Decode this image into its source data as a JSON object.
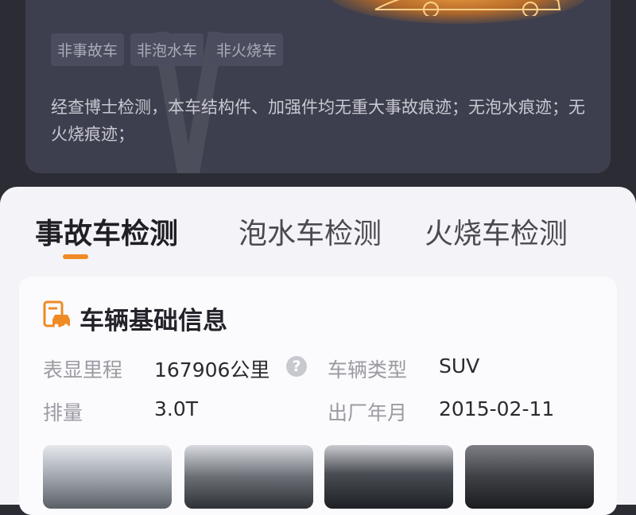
{
  "top_card": {
    "tags": [
      "非事故车",
      "非泡水车",
      "非火烧车"
    ],
    "summary": "经查博士检测，本车结构件、加强件均无重大事故痕迹；无泡水痕迹；无火烧痕迹；"
  },
  "tabs": [
    {
      "label": "事故车检测",
      "active": true
    },
    {
      "label": "泡水车检测",
      "active": false
    },
    {
      "label": "火烧车检测",
      "active": false
    }
  ],
  "vehicle_info": {
    "title": "车辆基础信息",
    "icon": "car-document-icon",
    "mileage_label": "表显里程",
    "mileage_value": "167906公里",
    "type_label": "车辆类型",
    "type_value": "SUV",
    "displacement_label": "排量",
    "displacement_value": "3.0T",
    "date_label": "出厂年月",
    "date_value": "2015-02-11"
  },
  "colors": {
    "accent": "#f08a24",
    "dark_bg": "#2b2c34",
    "card_bg": "#3d3f4e"
  }
}
